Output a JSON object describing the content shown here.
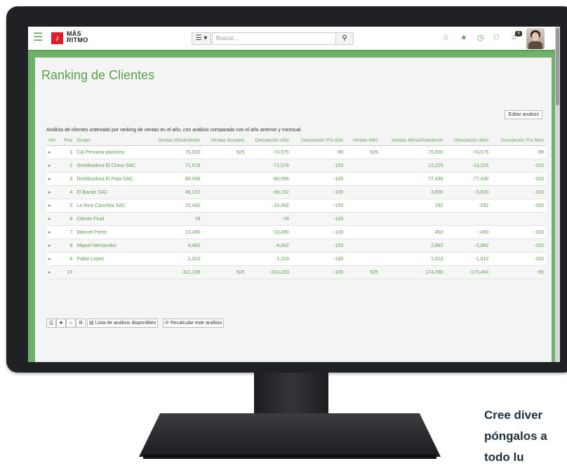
{
  "header": {
    "logo_text_1": "MÁS",
    "logo_text_2": "RITMO",
    "search_placeholder": "Buscar...",
    "menu_icon": "list-icon",
    "notification_count": "9"
  },
  "page": {
    "title": "Ranking de Clientes",
    "edit_button": "Editar análisis",
    "description": "Análisis de clientes ordenado por ranking de ventas en el año, con análisis comparado con el año anterior y mensual."
  },
  "table": {
    "headers": [
      "Ver",
      "Pos",
      "Grupo",
      "Ventas AñoAnterior",
      "Ventas Anuales",
      "Desviación Año",
      "Desviación Pct Año",
      "Ventas Mes",
      "Ventas MesAñoAnterior",
      "Desviación Mes",
      "Desviación Pct Mes"
    ],
    "rows": [
      {
        "pos": "1",
        "grupo": "Cia Peruana plasticos",
        "vaa": "75,500",
        "va": "925",
        "da": "-74,575",
        "dpa": "-99",
        "vm": "925",
        "vmaa": "75,500",
        "dm": "-74,575",
        "dpm": "-99"
      },
      {
        "pos": "2",
        "grupo": "Distribuidora El Chino SAC",
        "vaa": "71,578",
        "va": "",
        "da": "-71,578",
        "dpa": "-100",
        "vm": "",
        "vmaa": "13,225",
        "dm": "-13,225",
        "dpm": "-100"
      },
      {
        "pos": "3",
        "grupo": "Distribuidora El Pata SAC",
        "vaa": "80,096",
        "va": "",
        "da": "-80,096",
        "dpa": "-100",
        "vm": "",
        "vmaa": "77,430",
        "dm": "-77,430",
        "dpm": "-100"
      },
      {
        "pos": "4",
        "grupo": "El Bacán SAC",
        "vaa": "49,152",
        "va": "",
        "da": "-49,152",
        "dpa": "-100",
        "vm": "",
        "vmaa": "3,600",
        "dm": "-3,600",
        "dpm": "-100"
      },
      {
        "pos": "5",
        "grupo": "La Rica Canchita SAC",
        "vaa": "15,492",
        "va": "",
        "da": "-15,492",
        "dpa": "-100",
        "vm": "",
        "vmaa": "292",
        "dm": "-292",
        "dpm": "-100"
      },
      {
        "pos": "6",
        "grupo": "Cliente Final",
        "vaa": "78",
        "va": "",
        "da": "-78",
        "dpa": "-100",
        "vm": "",
        "vmaa": "",
        "dm": "",
        "dpm": ""
      },
      {
        "pos": "7",
        "grupo": "Manuel Perez",
        "vaa": "13,490",
        "va": "",
        "da": "-13,490",
        "dpa": "-100",
        "vm": "",
        "vmaa": "450",
        "dm": "-450",
        "dpm": "-100"
      },
      {
        "pos": "8",
        "grupo": "Miguel Hernandez",
        "vaa": "4,462",
        "va": "",
        "da": "-4,462",
        "dpa": "-100",
        "vm": "",
        "vmaa": "2,882",
        "dm": "-2,882",
        "dpm": "-100"
      },
      {
        "pos": "9",
        "grupo": "Pablo Lopez",
        "vaa": "1,310",
        "va": "",
        "da": "-1,310",
        "dpa": "-100",
        "vm": "",
        "vmaa": "1,010",
        "dm": "-1,010",
        "dpm": "-100"
      },
      {
        "pos": "10",
        "grupo": "",
        "vaa": "311,159",
        "va": "925",
        "da": "-310,233",
        "dpa": "-100",
        "vm": "925",
        "vmaa": "174,390",
        "dm": "-173,464",
        "dpm": "-99"
      }
    ]
  },
  "tools": {
    "list_button": "Lista de análisis disponibles",
    "recalc_button": "Recalcular este análisis"
  },
  "promo": {
    "line1": "Cree diver",
    "line2": "póngalos a",
    "line3": "todo lu"
  },
  "colors": {
    "accent": "#5aa04f",
    "background": "#6fb06b",
    "logo": "#e11d2a"
  }
}
